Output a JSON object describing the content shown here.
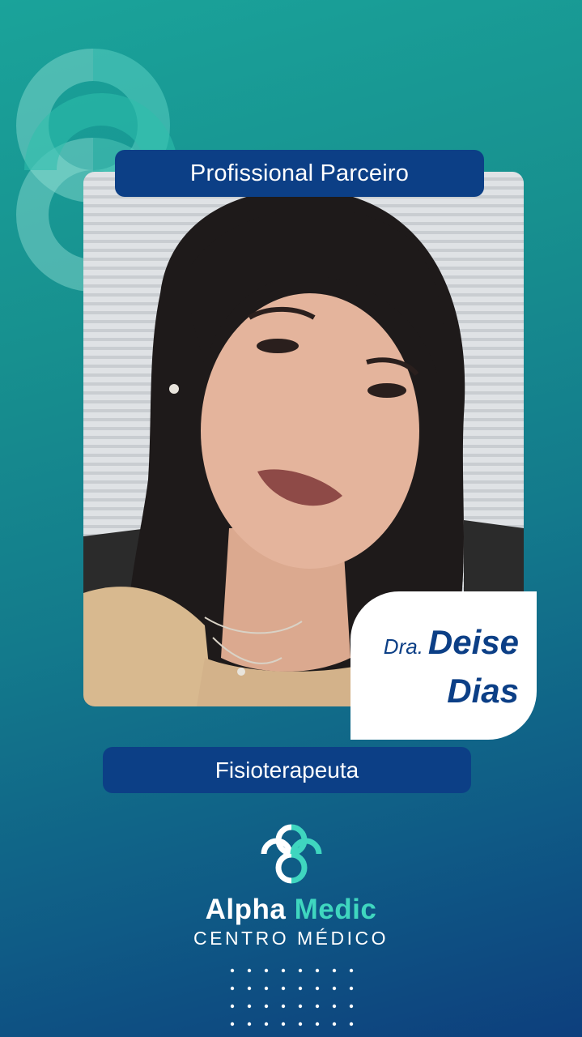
{
  "badge": {
    "label": "Profissional Parceiro"
  },
  "doctor": {
    "prefix": "Dra.",
    "first_name": "Deise",
    "last_name": "Dias"
  },
  "specialty": {
    "label": "Fisioterapeuta"
  },
  "brand": {
    "name_part1": "Alpha",
    "name_part2": "Medic",
    "subtitle": "CENTRO MÉDICO"
  },
  "colors": {
    "navy": "#0c3f86",
    "teal": "#1aa39a",
    "accent": "#3fd6bf",
    "white": "#ffffff"
  },
  "icons": {
    "background_logo": "medical-cross-logo",
    "brand_logo": "medical-cross-logo"
  }
}
